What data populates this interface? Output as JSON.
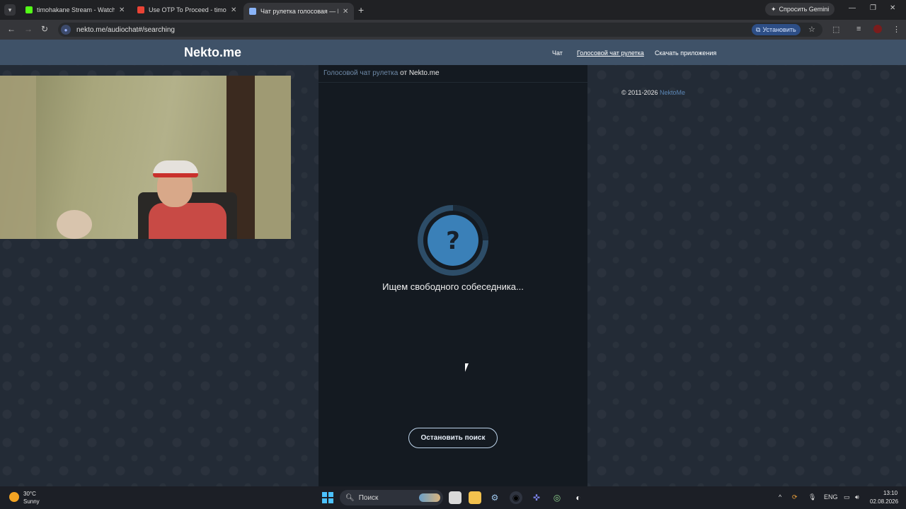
{
  "browser": {
    "tabs": [
      {
        "title": "timohakane Stream - Watch Liv",
        "favicon_color": "#53fc18"
      },
      {
        "title": "Use OTP To Proceed - timohais",
        "favicon_color": "#ea4335"
      },
      {
        "title": "Чат рулетка голосовая — Н",
        "favicon_color": "#8ab4f8"
      }
    ],
    "new_tab": "+",
    "gemini_label": "Спросить Gemini",
    "url": "nekto.me/audiochat#/searching",
    "install_label": "Установить"
  },
  "site": {
    "logo": "Nekto.me",
    "nav": [
      "Чат",
      "Голосовой чат рулетка",
      "Скачать приложения"
    ],
    "breadcrumb_link": "Голосовой чат рулетка",
    "breadcrumb_rest": "от Nekto.me",
    "spinner_symbol": "?",
    "searching_text": "Ищем свободного собеседника...",
    "stop_button": "Остановить поиск",
    "copyright_prefix": "© 2011-2026",
    "copyright_link": "NektoMe"
  },
  "taskbar": {
    "weather_temp": "30°C",
    "weather_desc": "Sunny",
    "search_placeholder": "Поиск",
    "language": "ENG",
    "time": "13:10",
    "date": "02.08.2026"
  },
  "colors": {
    "header_bg": "#3f5268",
    "page_bg": "#232b36",
    "panel_bg": "#141a21",
    "accent": "#5b86b5"
  }
}
